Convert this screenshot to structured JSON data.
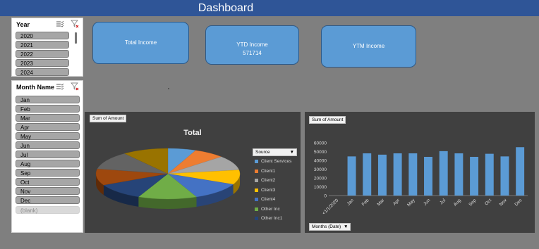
{
  "header": {
    "title": "Dashboard"
  },
  "year_slicer": {
    "title": "Year",
    "items": [
      {
        "label": "2020"
      },
      {
        "label": "2021"
      },
      {
        "label": "2022"
      },
      {
        "label": "2023"
      },
      {
        "label": "2024"
      }
    ]
  },
  "month_slicer": {
    "title": "Month Name",
    "items": [
      {
        "label": "Jan"
      },
      {
        "label": "Feb"
      },
      {
        "label": "Mar"
      },
      {
        "label": "Apr"
      },
      {
        "label": "May"
      },
      {
        "label": "Jun"
      },
      {
        "label": "Jul"
      },
      {
        "label": "Aug"
      },
      {
        "label": "Sep"
      },
      {
        "label": "Oct"
      },
      {
        "label": "Nov"
      },
      {
        "label": "Dec"
      },
      {
        "label": "(blank)"
      }
    ]
  },
  "cards": {
    "total_income": {
      "label": "Total Income"
    },
    "ytd_income": {
      "label": "YTD Income",
      "value": "571714"
    },
    "ytm_income": {
      "label": "YTM Income"
    }
  },
  "pie_panel": {
    "field_button": "Sum of Amount",
    "legend_filter": "Source"
  },
  "bar_panel": {
    "field_button": "Sum of Amount",
    "axis_filter": "Months (Date)"
  },
  "chart_data": [
    {
      "type": "pie",
      "title": "Total",
      "series": [
        {
          "name": "Client Services",
          "color": "#5b9bd5"
        },
        {
          "name": "Client1",
          "color": "#ed7d31"
        },
        {
          "name": "Client2",
          "color": "#a5a5a5"
        },
        {
          "name": "Client3",
          "color": "#ffc000"
        },
        {
          "name": "Client4",
          "color": "#4472c4"
        },
        {
          "name": "Other Inc",
          "color": "#70ad47"
        },
        {
          "name": "Other Inc1",
          "color": "#264478"
        }
      ],
      "slices": [
        {
          "color": "#5b9bd5",
          "value": 6.3
        },
        {
          "color": "#ed7d31",
          "value": 7.0
        },
        {
          "color": "#a5a5a5",
          "value": 9.3
        },
        {
          "color": "#ffc000",
          "value": 9.3
        },
        {
          "color": "#4472c4",
          "value": 11.6
        },
        {
          "color": "#70ad47",
          "value": 13.2
        },
        {
          "color": "#264478",
          "value": 10.9
        },
        {
          "color": "#9e480e",
          "value": 10.5
        },
        {
          "color": "#636363",
          "value": 11.6
        },
        {
          "color": "#997300",
          "value": 10.3
        }
      ],
      "legend_position": "right"
    },
    {
      "type": "bar",
      "categories": [
        "<1/1/2020",
        "Jan",
        "Feb",
        "Mar",
        "Apr",
        "May",
        "Jun",
        "Jul",
        "Aug",
        "Sep",
        "Oct",
        "Nov",
        "Dec"
      ],
      "values": [
        0,
        44500,
        48000,
        46500,
        48000,
        48000,
        44000,
        50500,
        48000,
        44000,
        47500,
        44500,
        55000
      ],
      "ylim": [
        0,
        60000
      ],
      "yticks": [
        0,
        10000,
        20000,
        30000,
        40000,
        50000,
        60000
      ],
      "color": "#5b9bd5",
      "grid": false
    }
  ]
}
